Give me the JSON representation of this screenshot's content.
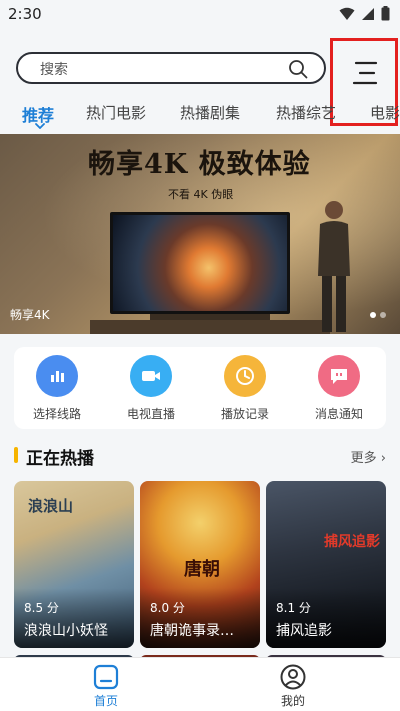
{
  "status": {
    "time": "2:30"
  },
  "search": {
    "placeholder": "搜索"
  },
  "tabs": [
    {
      "label": "推荐",
      "active": true
    },
    {
      "label": "热门电影"
    },
    {
      "label": "热播剧集"
    },
    {
      "label": "热播综艺"
    },
    {
      "label": "电影"
    }
  ],
  "banner": {
    "headline": "畅享4K 极致体验",
    "subline": "不看 4K 伪眼",
    "caption": "畅享4K"
  },
  "quick_actions": [
    {
      "label": "选择线路",
      "icon": "route-icon",
      "color": "#4a8df0"
    },
    {
      "label": "电视直播",
      "icon": "live-tv-icon",
      "color": "#38aef3"
    },
    {
      "label": "播放记录",
      "icon": "history-icon",
      "color": "#f5b53a"
    },
    {
      "label": "消息通知",
      "icon": "message-icon",
      "color": "#f06b84"
    }
  ],
  "section": {
    "title": "正在热播",
    "more": "更多"
  },
  "cards": [
    {
      "score": "8.5 分",
      "title": "浪浪山小妖怪"
    },
    {
      "score": "8.0 分",
      "title": "唐朝诡事录…"
    },
    {
      "score": "8.1 分",
      "title": "捕风追影"
    }
  ],
  "bottom_nav": [
    {
      "label": "首页",
      "icon": "home-icon",
      "active": true
    },
    {
      "label": "我的",
      "icon": "profile-icon"
    }
  ],
  "colors": {
    "accent": "#1e7fd6",
    "highlight_box": "#e3201f"
  }
}
